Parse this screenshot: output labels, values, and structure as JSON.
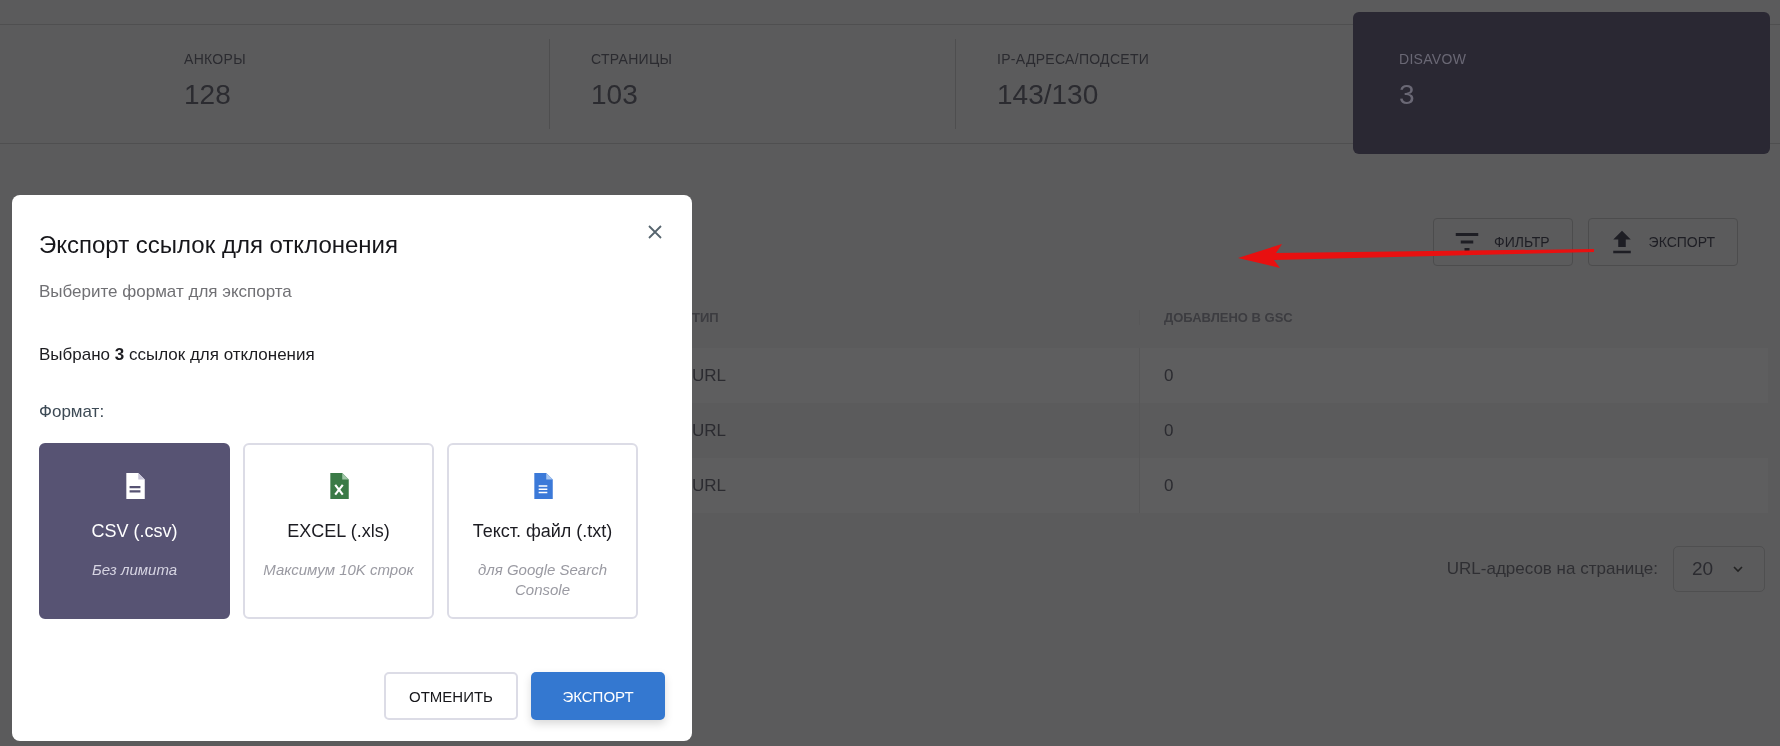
{
  "stats": [
    {
      "label": "АНКОРЫ",
      "value": "128",
      "selected": false
    },
    {
      "label": "СТРАНИЦЫ",
      "value": "103",
      "selected": false
    },
    {
      "label": "IP-АДРЕСА/ПОДСЕТИ",
      "value": "143/130",
      "selected": false
    },
    {
      "label": "DISAVOW",
      "value": "3",
      "selected": true
    }
  ],
  "toolbar": [
    {
      "kind": "filter",
      "label": "ФИЛЬТР"
    },
    {
      "kind": "upload",
      "label": "ЭКСПОРТ"
    }
  ],
  "table": {
    "columns": [
      "ТИП",
      "ДОБАВЛЕНО В GSC"
    ],
    "rows": [
      [
        "URL",
        "0"
      ],
      [
        "URL",
        "0"
      ],
      [
        "URL",
        "0"
      ]
    ]
  },
  "pagination": {
    "label": "URL-адресов на странице:",
    "value": "20"
  },
  "modal": {
    "title": "Экспорт ссылок для отклонения",
    "subtitle": "Выберите формат для экспорта",
    "summary": "Выбрано **3** ссылок для отклонения",
    "format_label": "Формат:",
    "formats": [
      {
        "kind": "csv",
        "label": "CSV (.csv)",
        "note": "Без лимита",
        "selected": true
      },
      {
        "kind": "excel",
        "label": "EXCEL (.xls)",
        "note": "Максимум 10K строк",
        "selected": false
      },
      {
        "kind": "text",
        "label": "Текст. файл (.txt)",
        "note": "для Google Search Console",
        "selected": false
      }
    ],
    "buttons": [
      {
        "kind": "secondary",
        "label": "ОТМЕНИТЬ"
      },
      {
        "kind": "primary",
        "label": "ЭКСПОРТ"
      }
    ]
  }
}
